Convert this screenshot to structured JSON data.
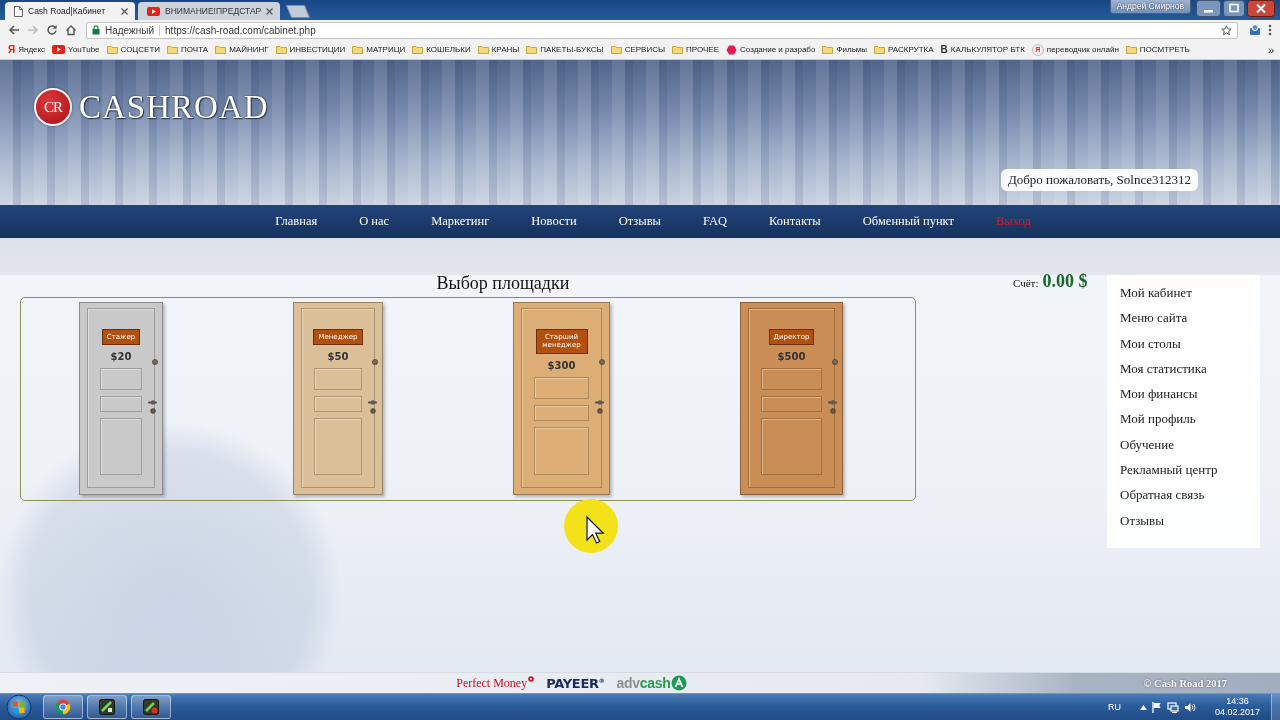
{
  "browser": {
    "tabs": [
      {
        "title": "Cash Road|Кабинет",
        "kind": "page",
        "selected": true
      },
      {
        "title": "ВНИМАНИЕ!ПРЕДСТАР",
        "kind": "video",
        "selected": false
      }
    ],
    "profile": "Андрей Смирнов",
    "nav_buttons": [
      {
        "kind": "back",
        "disabled": false
      },
      {
        "kind": "forward",
        "disabled": true
      },
      {
        "kind": "reload",
        "disabled": false
      },
      {
        "kind": "home",
        "disabled": false
      }
    ],
    "security": "Надежный",
    "url": "https://cash-road.com/cabinet.php",
    "bookmarks": [
      {
        "label": "Яндекс",
        "kind": "red-letter",
        "icon_text": "Я"
      },
      {
        "label": "YouTube",
        "kind": "video"
      },
      {
        "label": "СОЦСЕТИ",
        "kind": "folder"
      },
      {
        "label": "ПОЧТА",
        "kind": "folder"
      },
      {
        "label": "МАЙНИНГ",
        "kind": "folder"
      },
      {
        "label": "ИНВЕСТИЦИИ",
        "kind": "folder"
      },
      {
        "label": "МАТРИЦИ",
        "kind": "folder"
      },
      {
        "label": "КОШЕЛЬКИ",
        "kind": "folder"
      },
      {
        "label": "КРАНЫ",
        "kind": "folder"
      },
      {
        "label": "ПАКЕТЫ-БУКСЫ",
        "kind": "folder"
      },
      {
        "label": "СЕРВИСЫ",
        "kind": "folder"
      },
      {
        "label": "ПРОЧЕЕ",
        "kind": "folder"
      },
      {
        "label": "Создание и разрабо",
        "kind": "site"
      },
      {
        "label": "Фильмы",
        "kind": "folder"
      },
      {
        "label": "РАСКРУТКА",
        "kind": "folder"
      },
      {
        "label": "КАЛЬКУЛЯТОР БТК",
        "kind": "letter",
        "icon_text": "B"
      },
      {
        "label": "переводчик онлайн",
        "kind": "round-letter",
        "icon_text": "Я"
      },
      {
        "label": "ПОСМТРЕТЬ",
        "kind": "folder"
      }
    ],
    "bookmarks_more": "»"
  },
  "site": {
    "logo_mark": "CR",
    "logo_text": "CASHROAD",
    "welcome": "Добро пожаловать, Solnce312312",
    "nav": [
      {
        "label": "Главная",
        "kind": "link"
      },
      {
        "label": "О нас",
        "kind": "link"
      },
      {
        "label": "Маркетинг",
        "kind": "link"
      },
      {
        "label": "Новости",
        "kind": "link"
      },
      {
        "label": "Отзывы",
        "kind": "link"
      },
      {
        "label": "FAQ",
        "kind": "link"
      },
      {
        "label": "Контакты",
        "kind": "link"
      },
      {
        "label": "Обменный пункт",
        "kind": "link"
      },
      {
        "label": "Выход",
        "kind": "logout"
      }
    ],
    "page_title": "Выбор площадки",
    "account_label": "Счёт:",
    "balance": "0.00 $",
    "doors": [
      {
        "label": "Стажер",
        "price": "$20",
        "color": "#c9c9c9"
      },
      {
        "label": "Менеджер",
        "price": "$50",
        "color": "#dbbf98"
      },
      {
        "label": "Старший менеджер",
        "price": "$300",
        "color": "#dcae76"
      },
      {
        "label": "Директор",
        "price": "$500",
        "color": "#c98d55"
      }
    ],
    "sidebar": [
      "Мой кабинет",
      "Меню сайта",
      "Мои столы",
      "Моя статистика",
      "Мои финансы",
      "Мой профиль",
      "Обучение",
      "Рекламный центр",
      "Обратная связь",
      "Отзывы"
    ],
    "payments": [
      {
        "kind": "perfect-money",
        "text": "Perfect Money"
      },
      {
        "kind": "payeer",
        "text": "PAYEER$^{®}$"
      },
      {
        "kind": "advcash",
        "parts": [
          "adv",
          "cash"
        ]
      }
    ],
    "copyright": "© Cash Road 2017"
  },
  "taskbar": {
    "language": "RU",
    "time": "14:36",
    "date": "04.02.2017"
  }
}
